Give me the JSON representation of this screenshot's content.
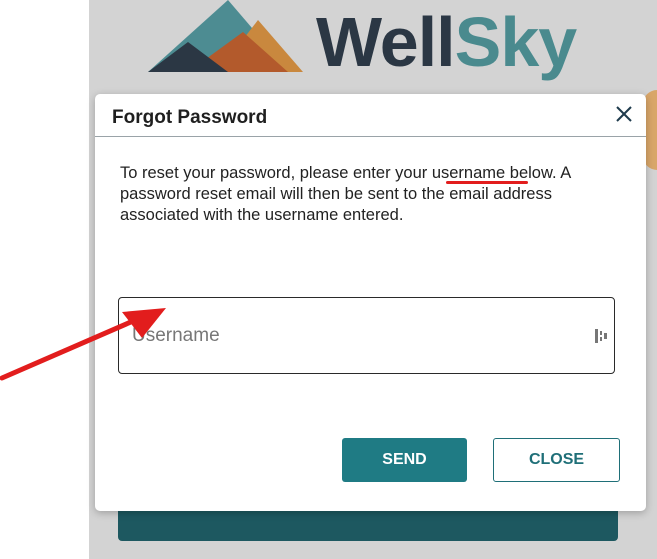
{
  "background": {
    "logo": {
      "part1": "Well",
      "part2": "Sky"
    }
  },
  "modal": {
    "title": "Forgot Password",
    "close_icon": "close-icon",
    "instructions_before": "To reset your password, please enter your ",
    "instructions_highlight": "username",
    "instructions_after": " below. A password reset email will then be sent to the email address associated with the username entered.",
    "username": {
      "value": "",
      "placeholder": "Username"
    },
    "send_label": "SEND",
    "close_label": "CLOSE"
  },
  "colors": {
    "accent": "#1f7b84",
    "annotation": "#e21d1d",
    "logo_dark": "#2b3744",
    "logo_teal": "#4a8a8e"
  }
}
